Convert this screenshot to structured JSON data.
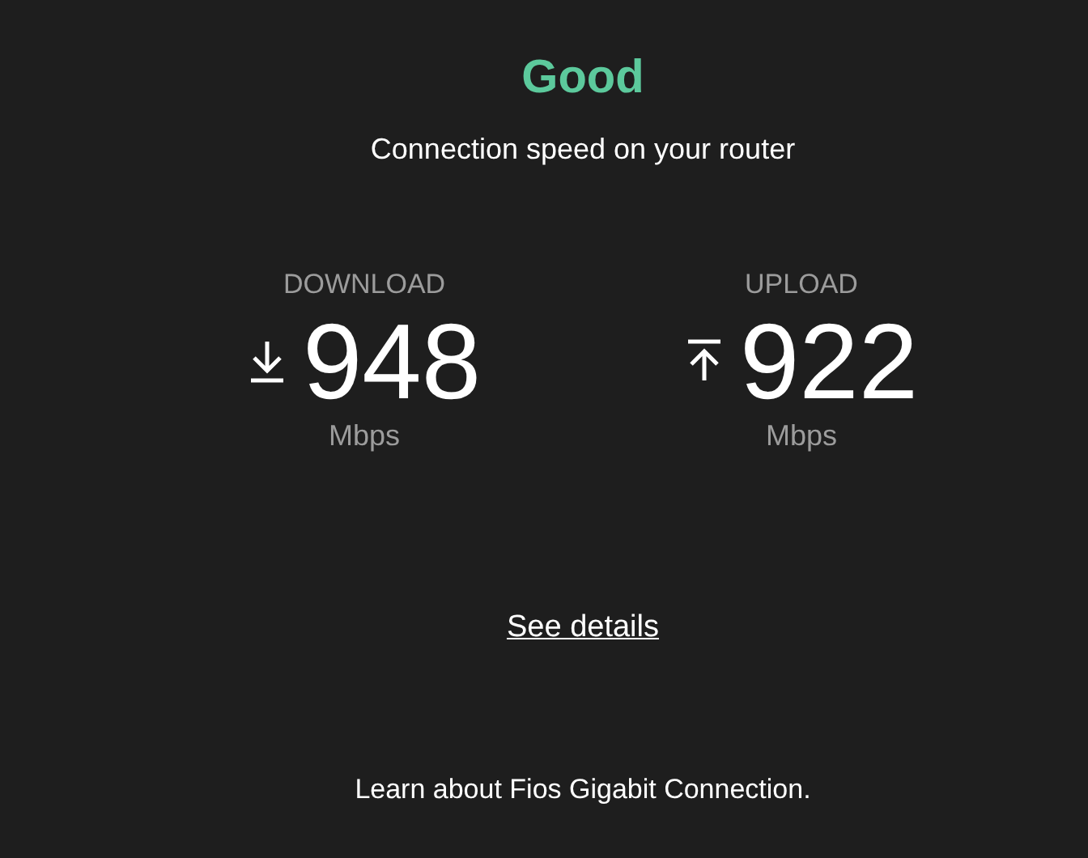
{
  "status": "Good",
  "subtitle": "Connection speed on your router",
  "speeds": [
    {
      "kind": "download",
      "label": "DOWNLOAD",
      "value": "948",
      "unit": "Mbps"
    },
    {
      "kind": "upload",
      "label": "UPLOAD",
      "value": "922",
      "unit": "Mbps"
    }
  ],
  "details_link": "See details",
  "footer_link": "Learn about Fios Gigabit Connection."
}
